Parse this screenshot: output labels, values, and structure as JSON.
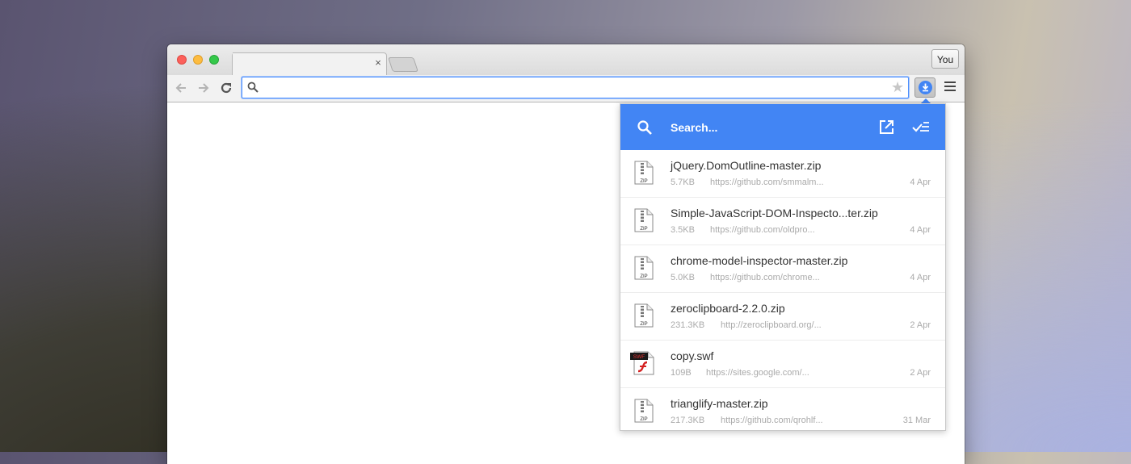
{
  "browser": {
    "profile_label": "You",
    "tab_close_glyph": "×",
    "omnibox_value": "",
    "omnibox_placeholder": ""
  },
  "downloads_popup": {
    "search_placeholder": "Search...",
    "accent_color": "#4285f4",
    "items": [
      {
        "name": "jQuery.DomOutline-master.zip",
        "size": "5.7KB",
        "url": "https://github.com/smmalm...",
        "date": "4 Apr",
        "icon": "zip-file-icon"
      },
      {
        "name": "Simple-JavaScript-DOM-Inspecto...ter.zip",
        "size": "3.5KB",
        "url": "https://github.com/oldpro...",
        "date": "4 Apr",
        "icon": "zip-file-icon"
      },
      {
        "name": "chrome-model-inspector-master.zip",
        "size": "5.0KB",
        "url": "https://github.com/chrome...",
        "date": "4 Apr",
        "icon": "zip-file-icon"
      },
      {
        "name": "zeroclipboard-2.2.0.zip",
        "size": "231.3KB",
        "url": "http://zeroclipboard.org/...",
        "date": "2 Apr",
        "icon": "zip-file-icon"
      },
      {
        "name": "copy.swf",
        "size": "109B",
        "url": "https://sites.google.com/...",
        "date": "2 Apr",
        "icon": "swf-file-icon"
      },
      {
        "name": "trianglify-master.zip",
        "size": "217.3KB",
        "url": "https://github.com/qrohlf...",
        "date": "31 Mar",
        "icon": "zip-file-icon"
      }
    ],
    "zip_label": "ZIP",
    "swf_label": "SWF"
  }
}
